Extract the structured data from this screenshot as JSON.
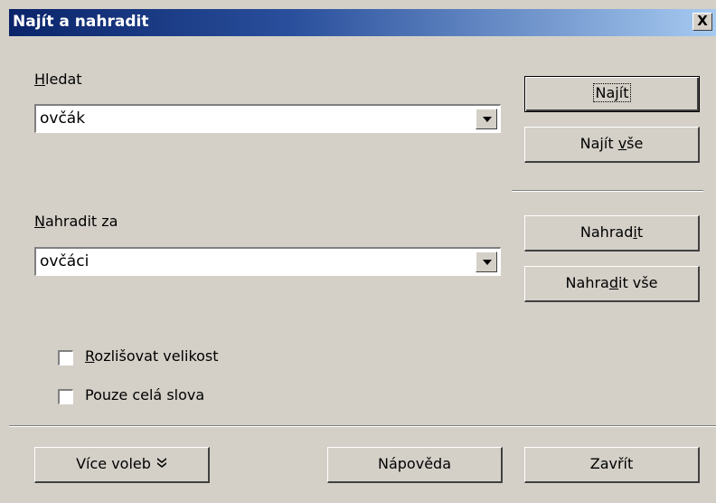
{
  "window": {
    "title": "Najít a nahradit",
    "close_symbol": "X"
  },
  "search": {
    "label_mnemonic": "H",
    "label_rest": "ledat",
    "value": "ovčák"
  },
  "replace": {
    "label_mnemonic": "N",
    "label_rest": "ahradit za",
    "value": "ovčáci"
  },
  "buttons": {
    "find_pre": "Na",
    "find_mnemonic": "j",
    "find_post": "ít",
    "find_all_pre": "Najít ",
    "find_all_mnemonic": "v",
    "find_all_post": "še",
    "replace_pre": "Nahrad",
    "replace_mnemonic": "i",
    "replace_post": "t",
    "replace_all_pre": "Nahra",
    "replace_all_mnemonic": "d",
    "replace_all_post": "it vše",
    "more_options": "Více voleb",
    "help": "Nápověda",
    "close": "Zavřít"
  },
  "options": {
    "match_case_mnemonic": "R",
    "match_case_rest": "ozlišovat velikost",
    "match_case_checked": false,
    "whole_words": "Pouze celá slova",
    "whole_words_checked": false
  },
  "icons": {
    "more_options": "double-chevron-down-icon",
    "dropdown": "triangle-down-icon",
    "close": "close-icon"
  },
  "colors": {
    "titlebar_start": "#0a246a",
    "titlebar_end": "#a6caf0",
    "face": "#d4d0c8"
  }
}
